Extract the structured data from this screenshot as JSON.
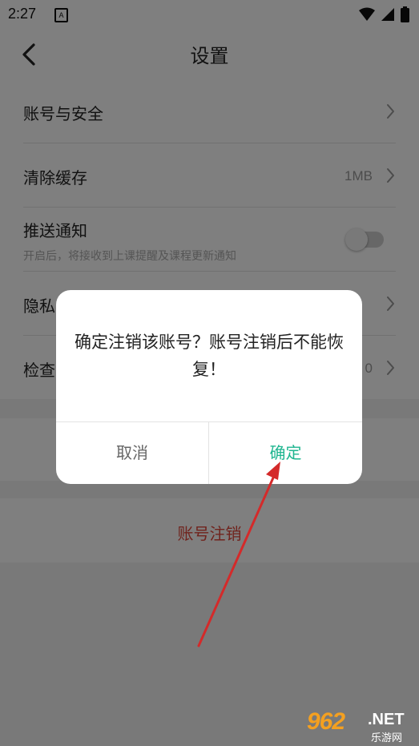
{
  "status_bar": {
    "time": "2:27",
    "notif_glyph": "A"
  },
  "header": {
    "title": "设置",
    "back_icon": "chevron-left-icon"
  },
  "settings": {
    "account_security": {
      "label": "账号与安全"
    },
    "clear_cache": {
      "label": "清除缓存",
      "value": "1MB"
    },
    "push": {
      "label": "推送通知",
      "description": "开启后，将接收到上课提醒及课程更新通知",
      "enabled": false
    },
    "privacy": {
      "label": "隐私"
    },
    "check_update": {
      "label": "检查",
      "value": "0"
    }
  },
  "logout_label": "账号注销",
  "dialog": {
    "message": "确定注销该账号？账号注销后不能恢复！",
    "cancel": "取消",
    "confirm": "确定"
  },
  "watermark": {
    "logo": "962",
    "suffix": ".NET",
    "subtitle": "乐游网"
  },
  "colors": {
    "confirm": "#1eb58f",
    "logout": "#e0473a",
    "arrow": "#d42a2a"
  }
}
